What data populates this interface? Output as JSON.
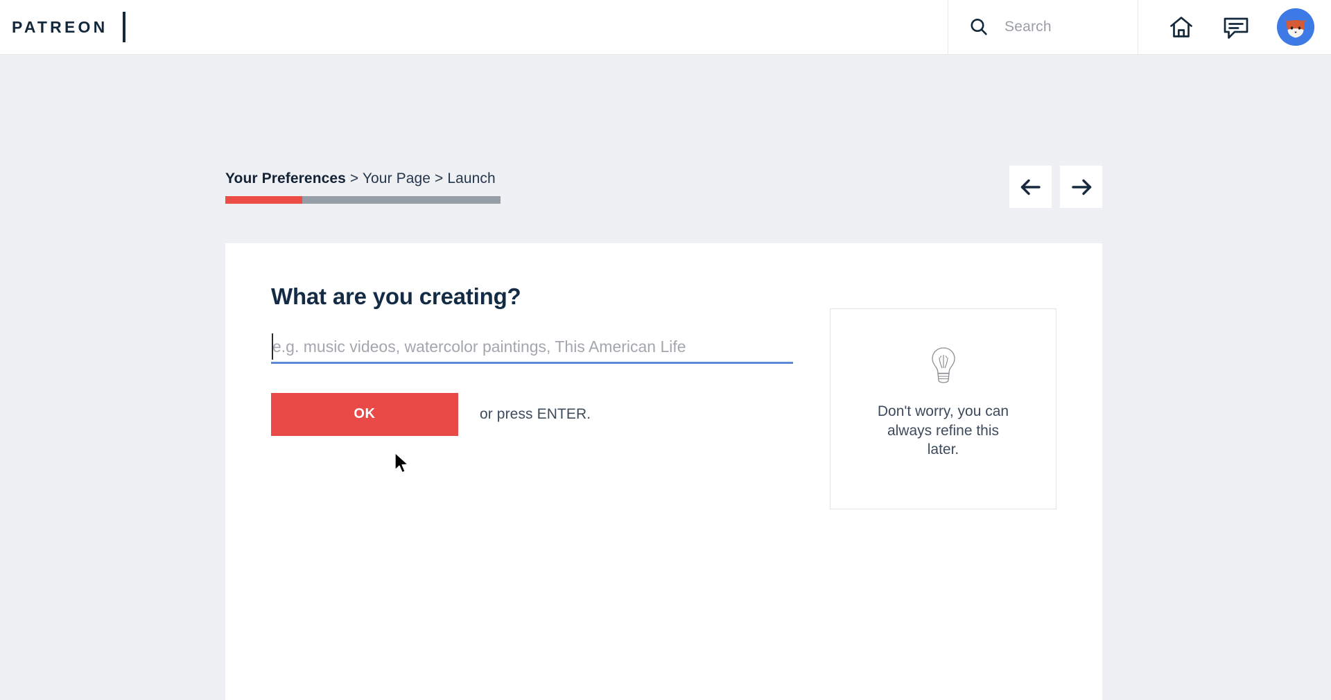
{
  "header": {
    "brand": "PATREON",
    "search": {
      "placeholder": "Search",
      "icon": "search-icon"
    },
    "icons": [
      {
        "name": "home-icon",
        "label": "Home"
      },
      {
        "name": "messages-icon",
        "label": "Messages"
      }
    ],
    "avatar": {
      "name": "user-avatar",
      "alt": "fox avatar"
    }
  },
  "breadcrumb": {
    "steps": [
      {
        "label": "Your Preferences",
        "active": true
      },
      {
        "label": "Your Page",
        "active": false
      },
      {
        "label": "Launch",
        "active": false
      }
    ],
    "separator": ">",
    "full_text": "Your Preferences > Your Page > Launch",
    "progress_percent": 28,
    "progress_fill_color": "#ec4d47",
    "progress_track_color": "#969ea7"
  },
  "nav": {
    "back_label": "←",
    "forward_label": "→"
  },
  "main": {
    "headline": "What are you creating?",
    "input": {
      "value": "",
      "placeholder": "e.g. music videos, watercolor paintings, This American Life",
      "underline_color": "#5c8ad8",
      "focused": true
    },
    "submit_label": "OK",
    "submit_color": "#e94a48",
    "hint": "or press ENTER."
  },
  "tip": {
    "icon": "lightbulb-icon",
    "text": "Don't worry, you can always refine this later."
  },
  "theme": {
    "page_background": "#eff0f4",
    "card_background": "#ffffff",
    "text_primary": "#132b44",
    "text_secondary": "#3d4b5c",
    "accent_red": "#e94a48",
    "accent_blue": "#5c8ad8",
    "avatar_blue": "#3d7ae5"
  }
}
